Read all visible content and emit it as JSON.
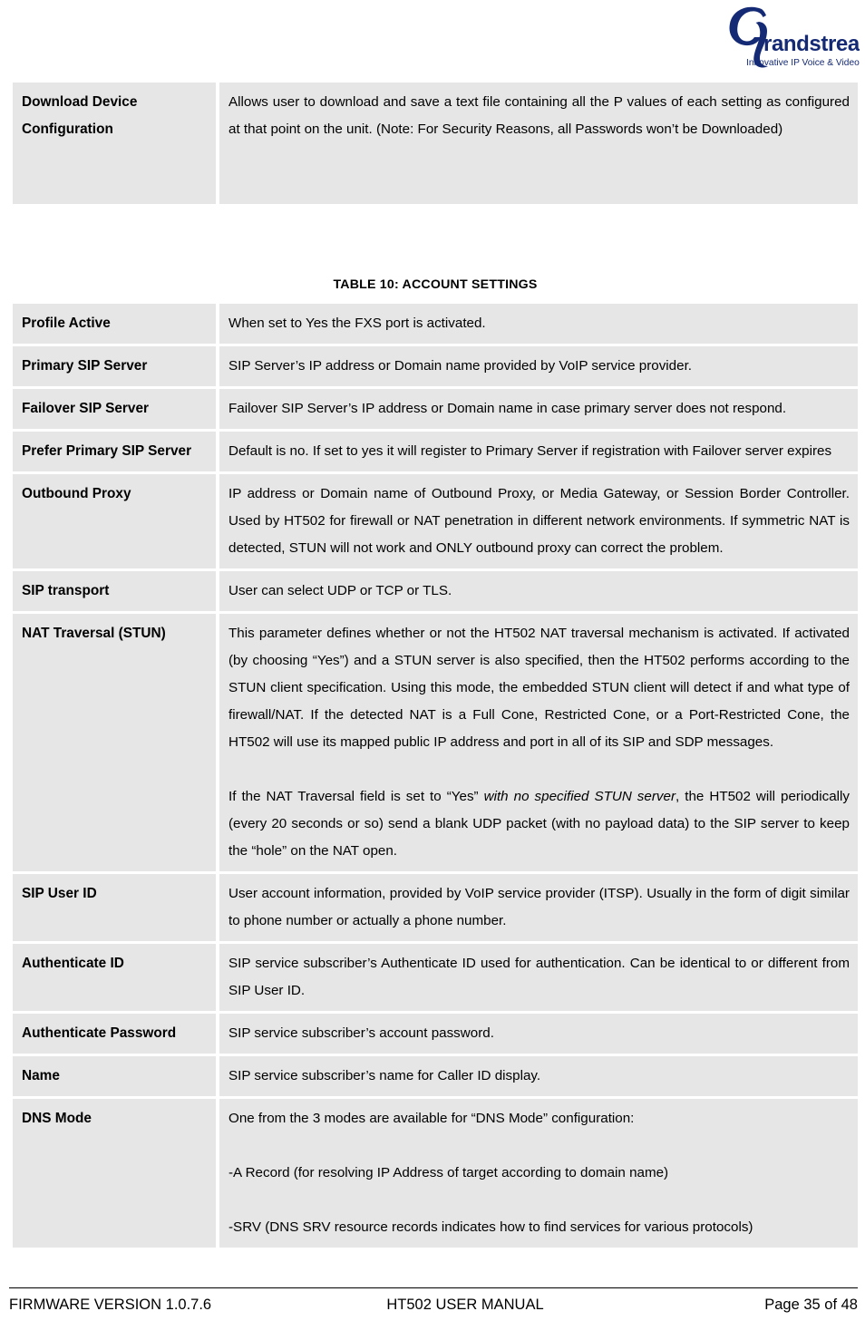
{
  "document": {
    "logo": {
      "icon": "grandstream-logo",
      "wordmark": "randstream",
      "monogram": "G",
      "tagline": "Innovative IP Voice & Video",
      "color": "#152a75"
    }
  },
  "top_table": {
    "rows": [
      {
        "key": "Download Device Configuration",
        "paragraphs": [
          "Allows user to download and save a text file containing all the P values of each setting as configured at that point on the unit. (Note: For Security Reasons, all Passwords won’t be Downloaded)"
        ]
      }
    ]
  },
  "account_table": {
    "caption": "TABLE 10:  ACCOUNT SETTINGS",
    "rows": [
      {
        "key": "Profile Active",
        "paragraphs": [
          "When set to Yes the FXS port is activated."
        ]
      },
      {
        "key": "Primary SIP Server",
        "paragraphs": [
          "SIP Server’s IP address or Domain name provided by VoIP service provider."
        ]
      },
      {
        "key": "Failover SIP Server",
        "paragraphs": [
          "Failover SIP Server’s IP address or Domain name in case primary server does not respond."
        ]
      },
      {
        "key": "Prefer Primary SIP Server",
        "paragraphs": [
          "Default is no. If set to yes it will register to Primary Server if registration with Failover server expires"
        ]
      },
      {
        "key": "Outbound Proxy",
        "paragraphs": [
          "IP address or Domain name of Outbound Proxy, or Media Gateway, or Session Border Controller.  Used by HT502 for firewall or NAT penetration in different network environments.  If symmetric NAT is detected, STUN will not work and ONLY outbound proxy can correct the problem."
        ]
      },
      {
        "key": "SIP transport",
        "paragraphs": [
          "User can select UDP or TCP or TLS."
        ]
      },
      {
        "key": "NAT Traversal (STUN)",
        "paragraphs": [
          "This parameter defines whether or not the HT502 NAT traversal mechanism is activated. If activated (by choosing “Yes”) and a STUN server is also specified, then the HT502 performs according to the STUN client specification. Using this mode, the embedded STUN client will detect if and what type of firewall/NAT.  If the detected NAT is a Full Cone, Restricted Cone, or a Port-Restricted Cone, the HT502 will use its mapped public IP address and port in all of its SIP and SDP messages."
        ],
        "paragraph2_parts": {
          "before": "If the NAT Traversal field is set to “Yes” ",
          "italic": "with no specified STUN server",
          "after": ", the HT502 will periodically (every 20 seconds or so) send a blank UDP packet (with no payload data) to the SIP server to keep the “hole” on the NAT open."
        }
      },
      {
        "key": "SIP User ID",
        "paragraphs": [
          "User account information, provided by VoIP service provider (ITSP). Usually in the form of digit similar to phone number or actually a phone number."
        ]
      },
      {
        "key": "Authenticate ID",
        "paragraphs": [
          "SIP service subscriber’s Authenticate ID used for authentication. Can be identical to or different from SIP User ID."
        ]
      },
      {
        "key": "Authenticate Password",
        "paragraphs": [
          "SIP service subscriber’s account password."
        ]
      },
      {
        "key": "Name",
        "paragraphs": [
          "SIP service subscriber’s name for Caller ID display."
        ]
      },
      {
        "key": "DNS Mode",
        "paragraphs": [
          "One from the 3 modes are available for “DNS Mode” configuration:",
          "-A Record (for resolving IP Address of target according to domain name)",
          "-SRV (DNS SRV resource records indicates how to find services for various protocols)"
        ]
      }
    ]
  },
  "footer": {
    "left": "FIRMWARE VERSION 1.0.7.6",
    "center": "HT502 USER MANUAL",
    "right": "Page 35 of 48"
  }
}
